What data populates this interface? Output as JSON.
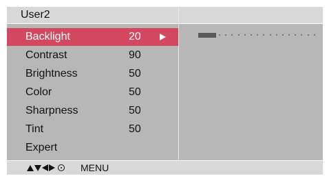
{
  "header": {
    "title": "User2"
  },
  "menu": {
    "items": [
      {
        "label": "Backlight",
        "value": "20",
        "selected": true
      },
      {
        "label": "Contrast",
        "value": "90"
      },
      {
        "label": "Brightness",
        "value": "50"
      },
      {
        "label": "Color",
        "value": "50"
      },
      {
        "label": "Sharpness",
        "value": "50"
      },
      {
        "label": "Tint",
        "value": "50"
      },
      {
        "label": "Expert",
        "value": ""
      }
    ]
  },
  "slider": {
    "value": 20,
    "min": 0,
    "max": 100
  },
  "footer": {
    "label": "MENU"
  },
  "icons": {
    "nav": [
      "triangle-up-icon",
      "triangle-down-icon",
      "triangle-left-icon",
      "triangle-right-icon",
      "ok-circle-icon"
    ]
  },
  "colors": {
    "selected": "#d3475f",
    "panel": "#b7b7b7",
    "header": "#d8d8d8"
  }
}
